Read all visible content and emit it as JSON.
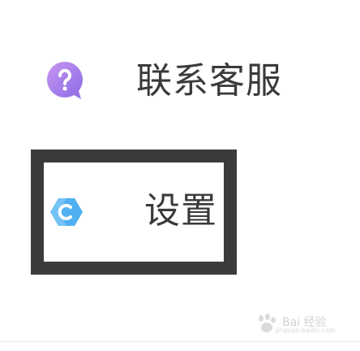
{
  "menu": {
    "contact": {
      "label": "联系客服",
      "icon": "question-mark-icon",
      "icon_gradient": [
        "#c08cf0",
        "#8e6ee6"
      ]
    },
    "settings": {
      "label": "设置",
      "icon": "settings-icon",
      "icon_color": "#3ea6f0",
      "highlighted": true,
      "highlight_color": "#3b3b3b"
    }
  },
  "watermark": {
    "text": "Bai 经验",
    "sub": "jingyan.baidu.com"
  }
}
